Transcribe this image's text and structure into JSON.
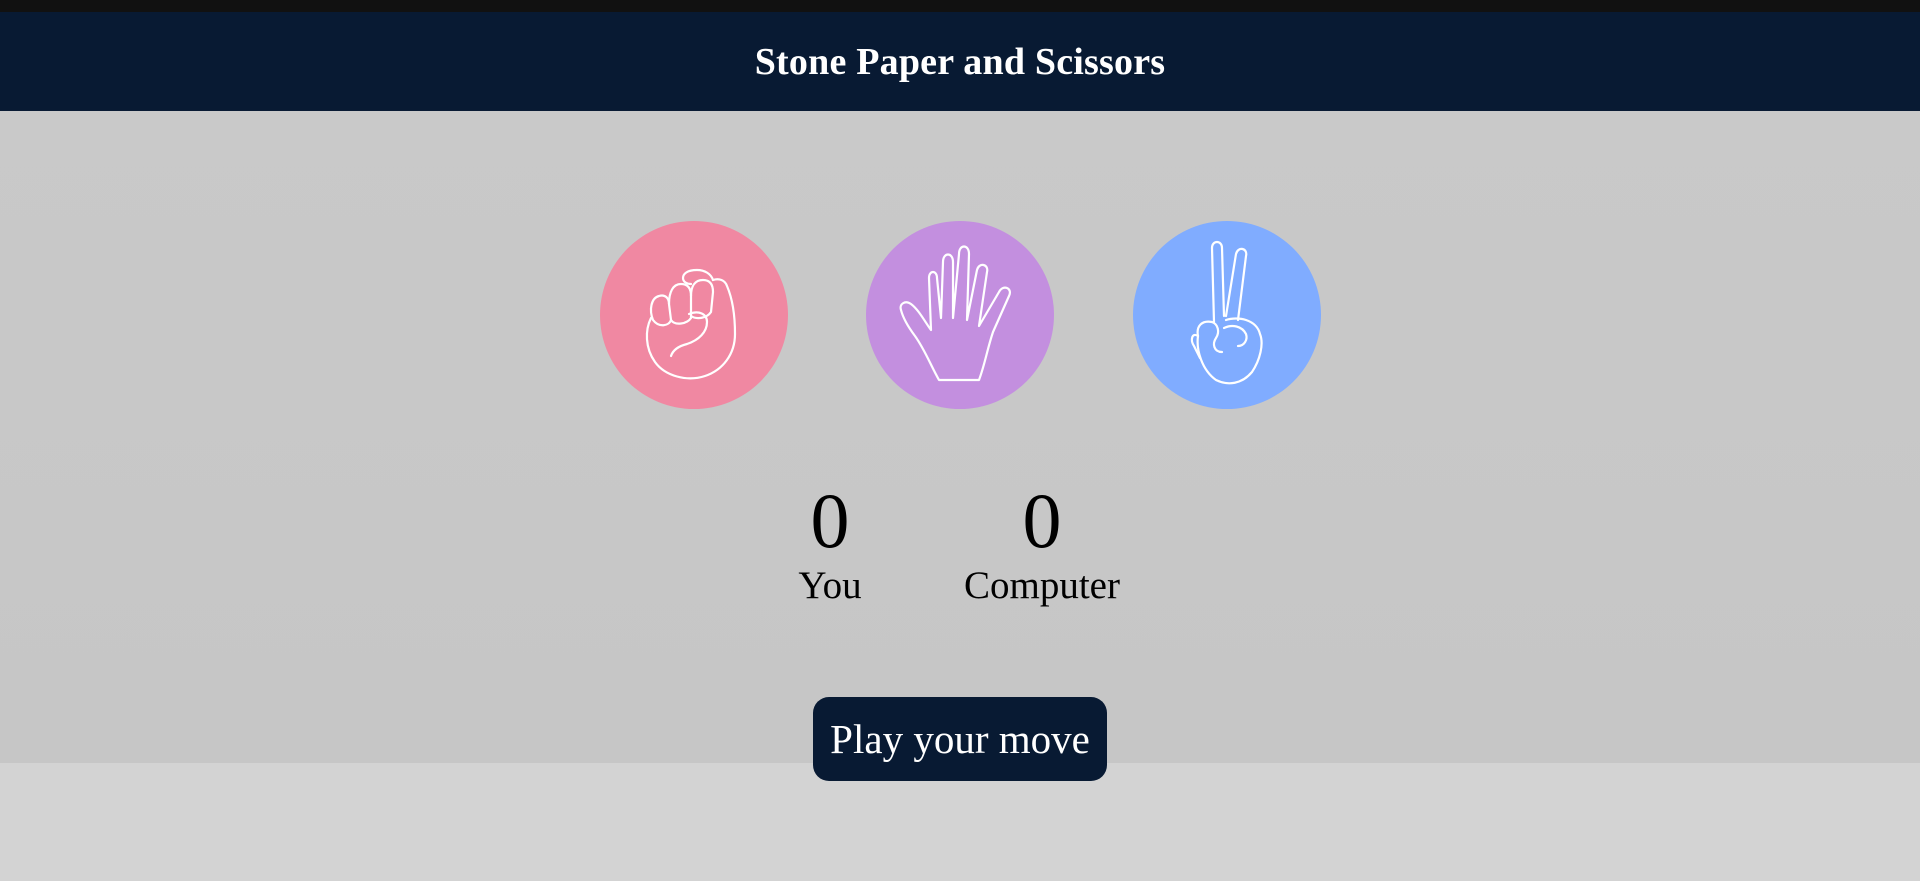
{
  "header": {
    "title": "Stone Paper and Scissors"
  },
  "choices": [
    {
      "id": "stone",
      "icon": "fist-icon",
      "color": "#f088a2"
    },
    {
      "id": "paper",
      "icon": "open-hand-icon",
      "color": "#c38fdf"
    },
    {
      "id": "scissors",
      "icon": "peace-hand-icon",
      "color": "#80acff"
    }
  ],
  "scores": {
    "user_score": "0",
    "user_label": "You",
    "computer_score": "0",
    "computer_label": "Computer"
  },
  "message": {
    "text": "Play your move"
  },
  "colors": {
    "header_bg": "#081a33",
    "message_bg": "#081a33",
    "game_bg": "#c8c8c8",
    "page_bg": "#d3d3d3"
  }
}
